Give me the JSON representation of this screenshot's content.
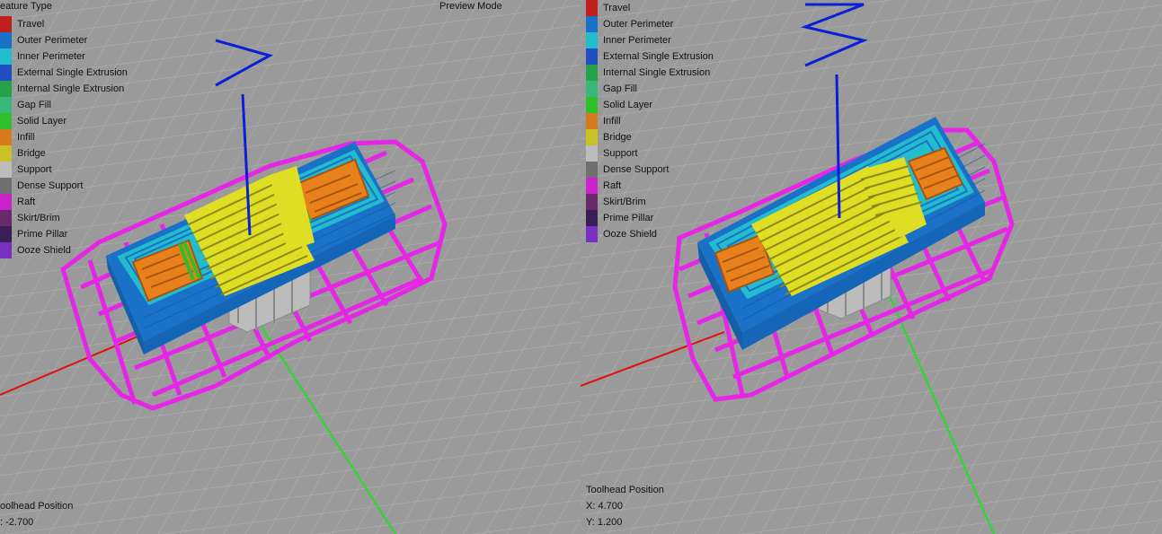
{
  "left_view": {
    "legend_title": "eature Type",
    "preview_mode_label": "Preview Mode",
    "toolhead": {
      "title": "oolhead Position",
      "coord": ": -2.700"
    }
  },
  "right_view": {
    "toolhead": {
      "title": "Toolhead Position",
      "x": "X: 4.700",
      "y": "Y: 1.200"
    }
  },
  "legend_left": [
    {
      "label": "Travel",
      "color": "#c0201c"
    },
    {
      "label": "Outer Perimeter",
      "color": "#1a72c8"
    },
    {
      "label": "Inner Perimeter",
      "color": "#22bccc"
    },
    {
      "label": "External Single Extrusion",
      "color": "#1f4fc0"
    },
    {
      "label": "Internal Single Extrusion",
      "color": "#26a34a"
    },
    {
      "label": "Gap Fill",
      "color": "#3cb77a"
    },
    {
      "label": "Solid Layer",
      "color": "#2ec02a"
    },
    {
      "label": "Infill",
      "color": "#d67a1e"
    },
    {
      "label": "Bridge",
      "color": "#c9c224"
    },
    {
      "label": "Support",
      "color": "#bcbcbc"
    },
    {
      "label": "Dense Support",
      "color": "#707070"
    },
    {
      "label": "Raft",
      "color": "#cc22cc"
    },
    {
      "label": "Skirt/Brim",
      "color": "#6a2a6a"
    },
    {
      "label": "Prime Pillar",
      "color": "#3a1f56"
    },
    {
      "label": "Ooze Shield",
      "color": "#7a2fc0"
    }
  ],
  "legend_right": [
    {
      "label": "Travel",
      "color": "#c0201c"
    },
    {
      "label": "Outer Perimeter",
      "color": "#1a72c8"
    },
    {
      "label": "Inner Perimeter",
      "color": "#22bccc"
    },
    {
      "label": "External Single Extrusion",
      "color": "#1f4fc0"
    },
    {
      "label": "Internal Single Extrusion",
      "color": "#26a34a"
    },
    {
      "label": "Gap Fill",
      "color": "#3cb77a"
    },
    {
      "label": "Solid Layer",
      "color": "#2ec02a"
    },
    {
      "label": "Infill",
      "color": "#d67a1e"
    },
    {
      "label": "Bridge",
      "color": "#c9c224"
    },
    {
      "label": "Support",
      "color": "#bcbcbc"
    },
    {
      "label": "Dense Support",
      "color": "#707070"
    },
    {
      "label": "Raft",
      "color": "#cc22cc"
    },
    {
      "label": "Skirt/Brim",
      "color": "#6a2a6a"
    },
    {
      "label": "Prime Pillar",
      "color": "#3a1f56"
    },
    {
      "label": "Ooze Shield",
      "color": "#7a2fc0"
    }
  ],
  "colors": {
    "background": "#9a9a9a",
    "grid": "#b4b4b4",
    "axis_x": "#e01010",
    "axis_y": "#20e020",
    "travel_path": "#0a1fd6",
    "raft": "#e626e6",
    "outer_perimeter": "#1a72c8",
    "inner_perimeter": "#22bccc",
    "infill": "#e8801c",
    "bridge": "#e0de24",
    "solid_layer": "#2ec02a",
    "support": "#bcbcbc"
  }
}
